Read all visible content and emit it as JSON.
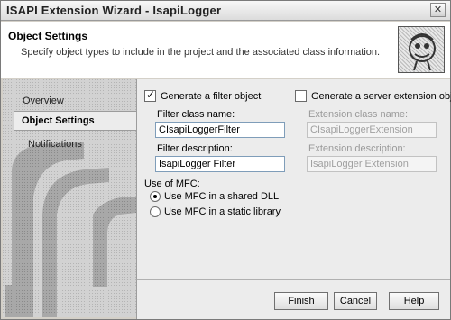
{
  "window": {
    "title": "ISAPI Extension Wizard - IsapiLogger",
    "close_glyph": "✕"
  },
  "header": {
    "title": "Object Settings",
    "description": "Specify object types to include in the project and the associated class information."
  },
  "nav": {
    "items": [
      {
        "label": "Overview"
      },
      {
        "label": "Object Settings",
        "selected": true
      },
      {
        "label": "Notifications"
      }
    ]
  },
  "filter": {
    "checkbox_label": "Generate a filter object",
    "checked": true,
    "class_name_label": "Filter class name:",
    "class_name_value": "CIsapiLoggerFilter",
    "description_label": "Filter description:",
    "description_value": "IsapiLogger Filter"
  },
  "extension": {
    "checkbox_label": "Generate a server extension object",
    "checked": false,
    "class_name_label": "Extension class name:",
    "class_name_value": "CIsapiLoggerExtension",
    "description_label": "Extension description:",
    "description_value": "IsapiLogger Extension"
  },
  "mfc": {
    "label": "Use of MFC:",
    "options": [
      {
        "label": "Use MFC in a shared DLL",
        "selected": true
      },
      {
        "label": "Use MFC in a static library",
        "selected": false
      }
    ]
  },
  "buttons": {
    "finish": "Finish",
    "cancel": "Cancel",
    "help": "Help"
  }
}
